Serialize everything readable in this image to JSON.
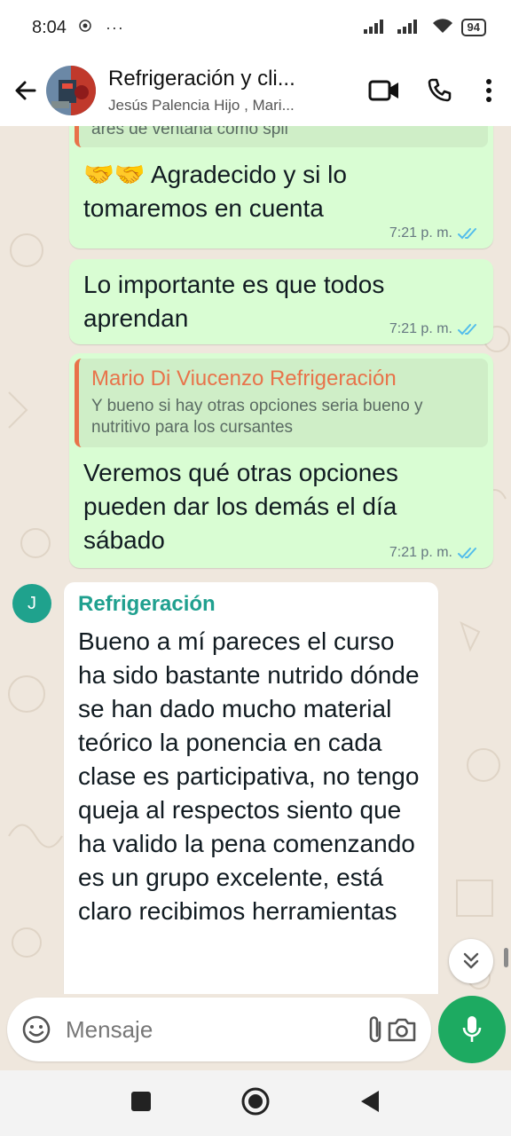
{
  "status_bar": {
    "time": "8:04",
    "dots": "···",
    "battery": "94"
  },
  "header": {
    "title": "Refrigeración y cli...",
    "subtitle": "Jesús Palencia Hijo , Mari..."
  },
  "messages": [
    {
      "type": "out-partial",
      "quoted_fragment": "ares de ventana como spli",
      "text": "🤝🤝 Agradecido y si lo tomaremos en cuenta",
      "time": "7:21 p. m."
    },
    {
      "type": "out",
      "text": "Lo importante es que todos aprendan",
      "time": "7:21 p. m."
    },
    {
      "type": "out-reply",
      "quote_name": "Mario Di Viucenzo Refrigeración",
      "quote_text": "Y bueno si hay otras opciones seria bueno y nutritivo para los cursantes",
      "text": "Veremos qué otras opciones pueden dar los demás el día sábado",
      "time": "7:21 p. m."
    },
    {
      "type": "in",
      "avatar_letter": "J",
      "sender": "Refrigeración",
      "text": "Bueno a mí pareces el curso ha sido bastante nutrido dónde se han dado mucho material teórico la ponencia en cada clase es participativa, no tengo queja al respectos siento que ha valido la pena comenzando es un grupo excelente, está claro recibimos herramientas"
    }
  ],
  "composer": {
    "placeholder": "Mensaje"
  },
  "colors": {
    "outgoing_bubble": "#d9fdd3",
    "incoming_bubble": "#ffffff",
    "quote_accent": "#e8734a",
    "sender_name": "#20a08f",
    "mic_button": "#1daa61",
    "read_ticks": "#53bdeb"
  }
}
